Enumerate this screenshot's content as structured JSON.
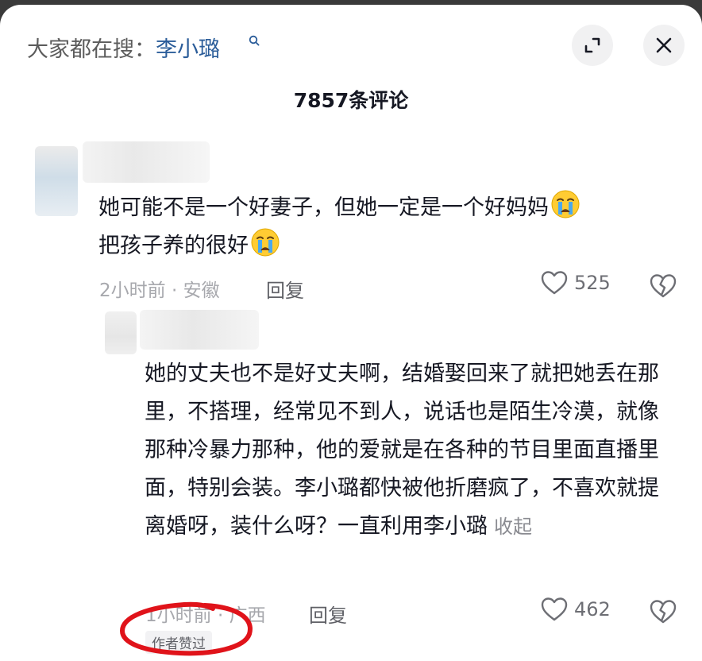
{
  "header": {
    "search_hint_prefix": "大家都在搜：",
    "search_hint_term": "李小璐",
    "comment_count_title": "7857条评论"
  },
  "comments": [
    {
      "text_line1": "她可能不是一个好妻子，但她一定是一个好妈妈",
      "text_line2": "把孩子养的很好",
      "meta": "2小时前 · 安徽",
      "reply_label": "回复",
      "likes": "525"
    },
    {
      "text": "她的丈夫也不是好丈夫啊，结婚娶回来了就把她丢在那里，不搭理，经常见不到人，说话也是陌生冷漠，就像那种冷暴力那种，他的爱就是在各种的节目里面直播里面，特别会装。李小璐都快被他折磨疯了，不喜欢就提离婚呀，装什么呀？一直利用李小璐",
      "collapse_label": "收起",
      "meta": "1小时前 · 广西",
      "reply_label": "回复",
      "likes": "462",
      "author_badge": "作者赞过"
    }
  ],
  "colors": {
    "search_term": "#2a5c99",
    "annotation_red": "#e0131a"
  }
}
